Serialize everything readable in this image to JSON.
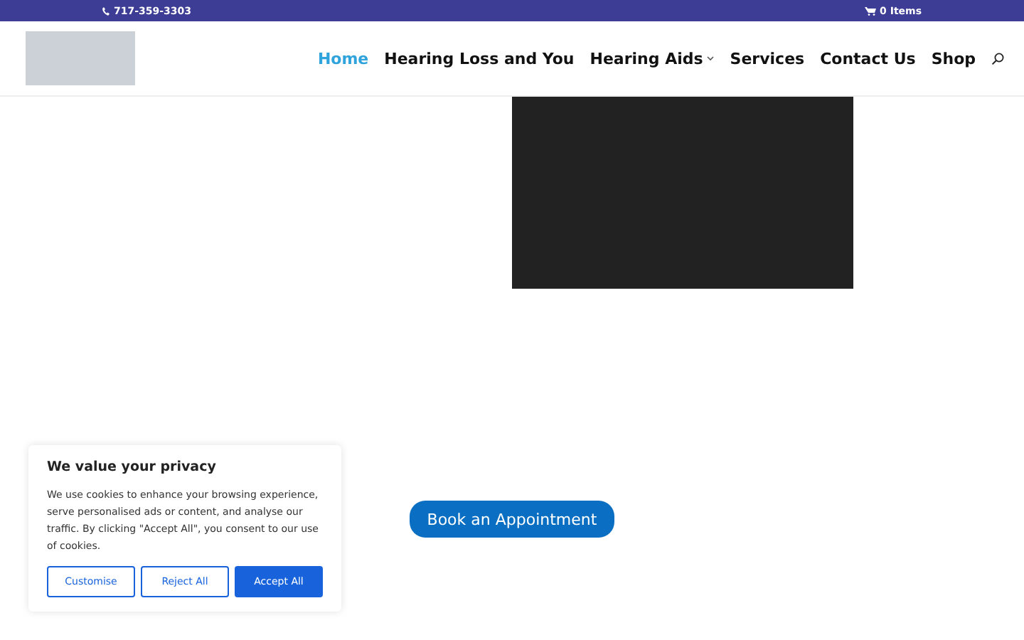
{
  "top_bar": {
    "phone": "717-359-3303",
    "cart": "0 Items"
  },
  "nav": {
    "items": [
      {
        "label": "Home",
        "selected": true,
        "has_submenu": false
      },
      {
        "label": "Hearing Loss and You",
        "selected": false,
        "has_submenu": false
      },
      {
        "label": "Hearing Aids",
        "selected": false,
        "has_submenu": true
      },
      {
        "label": "Services",
        "selected": false,
        "has_submenu": false
      },
      {
        "label": "Contact Us",
        "selected": false,
        "has_submenu": false
      },
      {
        "label": "Shop",
        "selected": false,
        "has_submenu": false
      }
    ]
  },
  "cta": {
    "label": "Book an Appointment"
  },
  "cookie_banner": {
    "title": "We value your privacy",
    "text": "We use cookies to enhance your browsing experience, serve personalised ads or content, and analyse our traffic. By clicking \"Accept All\", you consent to our use of cookies.",
    "buttons": [
      {
        "label": "Customise",
        "kind": "outline"
      },
      {
        "label": "Reject All",
        "kind": "outline"
      },
      {
        "label": "Accept All",
        "kind": "primary"
      }
    ]
  }
}
